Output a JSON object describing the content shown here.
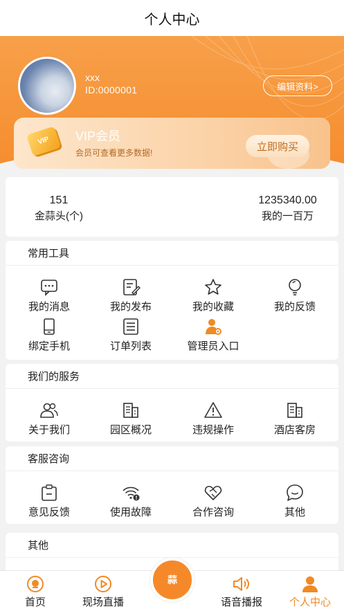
{
  "header": {
    "title": "个人中心"
  },
  "profile": {
    "name": "xxx",
    "id": "ID:0000001",
    "edit_label": "编辑资料>"
  },
  "vip": {
    "badge": "VIP",
    "title": "VIP会员",
    "subtitle": "会员可查看更多数据!",
    "buy_label": "立即购买"
  },
  "stats": [
    {
      "value": "151",
      "label": "金蒜头(个)"
    },
    {
      "value": "1235340.00",
      "label": "我的一百万"
    }
  ],
  "tools": {
    "title": "常用工具",
    "items": [
      {
        "label": "我的消息",
        "icon": "message-icon"
      },
      {
        "label": "我的发布",
        "icon": "edit-doc-icon"
      },
      {
        "label": "我的收藏",
        "icon": "star-icon"
      },
      {
        "label": "我的反馈",
        "icon": "bulb-icon"
      },
      {
        "label": "绑定手机",
        "icon": "phone-icon"
      },
      {
        "label": "订单列表",
        "icon": "list-icon"
      },
      {
        "label": "管理员入口",
        "icon": "admin-icon"
      }
    ]
  },
  "services": {
    "title": "我们的服务",
    "items": [
      {
        "label": "关于我们",
        "icon": "group-icon"
      },
      {
        "label": "园区概况",
        "icon": "building-icon"
      },
      {
        "label": "违规操作",
        "icon": "warning-icon"
      },
      {
        "label": "酒店客房",
        "icon": "hotel-icon"
      }
    ]
  },
  "support": {
    "title": "客服咨询",
    "items": [
      {
        "label": "意见反馈",
        "icon": "clipboard-icon"
      },
      {
        "label": "使用故障",
        "icon": "wifi-error-icon"
      },
      {
        "label": "合作咨询",
        "icon": "handshake-icon"
      },
      {
        "label": "其他",
        "icon": "chat-icon"
      }
    ]
  },
  "other": {
    "title": "其他"
  },
  "tabbar": {
    "items": [
      {
        "label": "首页",
        "icon": "home-icon"
      },
      {
        "label": "现场直播",
        "icon": "play-icon"
      },
      {
        "label": "语音播报",
        "icon": "speaker-icon"
      },
      {
        "label": "个人中心",
        "icon": "user-icon",
        "active": true
      }
    ],
    "center_label": "蒜"
  },
  "colors": {
    "accent": "#f68c2c",
    "active_tab": "#f08a23"
  }
}
